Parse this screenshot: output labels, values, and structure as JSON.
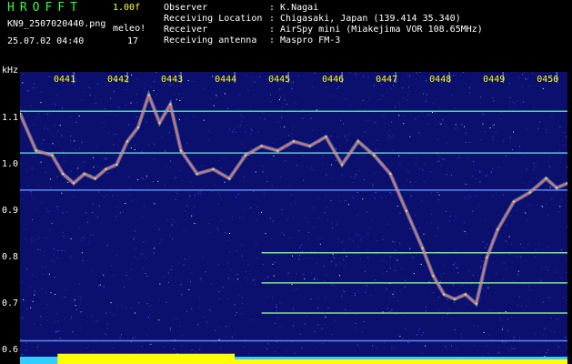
{
  "header": {
    "logo": "HROFFT",
    "version": "1.00f",
    "filename": "KN9_2507020440.png",
    "datetime": "25.07.02 04:40",
    "mode_label": "meleo!",
    "mode_value": "17",
    "meta": [
      {
        "label": "Observer",
        "value": ": K.Nagai"
      },
      {
        "label": "Receiving Location",
        "value": ": Chigasaki, Japan (139.414 35.340)"
      },
      {
        "label": "Receiver",
        "value": ": AirSpy mini (Miakejima VOR 108.65MHz)"
      },
      {
        "label": "Receiving antenna",
        "value": ": Maspro FM-3"
      }
    ]
  },
  "colors": {
    "logo": "#33ff33",
    "version": "#ffff33",
    "info": "#ffffff",
    "background": "#0b0f6e",
    "bright_band": "#ffff00",
    "cyan_band": "#33ccff",
    "trace": "#ff6666"
  },
  "chart_data": {
    "type": "heatmap",
    "ylabel": "kHz",
    "y_ticks": [
      "1.1",
      "1.0",
      "0.9",
      "0.8",
      "0.7",
      "0.6"
    ],
    "y_tick_values": [
      1.1,
      1.0,
      0.9,
      0.8,
      0.7,
      0.6
    ],
    "ylim": [
      0.57,
      1.2
    ],
    "x_ticks": [
      "0441",
      "0442",
      "0443",
      "0444",
      "0445",
      "0446",
      "0447",
      "0448",
      "0449",
      "0450"
    ],
    "x_tick_values": [
      1,
      2,
      3,
      4,
      5,
      6,
      7,
      8,
      9,
      10
    ],
    "xlim": [
      0,
      10.2
    ],
    "horizontal_lines": [
      {
        "y": 1.115,
        "x_start": 0,
        "x_end": 10.2,
        "color": "#66ddcc"
      },
      {
        "y": 1.025,
        "x_start": 0,
        "x_end": 10.2,
        "color": "#66ddcc"
      },
      {
        "y": 0.945,
        "x_start": 0,
        "x_end": 10.2,
        "color": "#6699ff"
      },
      {
        "y": 0.81,
        "x_start": 4.5,
        "x_end": 10.2,
        "color": "#88ff88"
      },
      {
        "y": 0.745,
        "x_start": 4.5,
        "x_end": 10.2,
        "color": "#88ff88"
      },
      {
        "y": 0.68,
        "x_start": 4.5,
        "x_end": 10.2,
        "color": "#88ff88"
      },
      {
        "y": 0.62,
        "x_start": 0,
        "x_end": 10.2,
        "color": "#6699ff"
      }
    ],
    "doppler_trace": {
      "x": [
        0,
        0.3,
        0.6,
        0.8,
        1.0,
        1.2,
        1.4,
        1.6,
        1.8,
        2.0,
        2.2,
        2.4,
        2.6,
        2.8,
        3.0,
        3.3,
        3.6,
        3.9,
        4.2,
        4.5,
        4.8,
        5.1,
        5.4,
        5.7,
        6.0,
        6.3,
        6.6,
        6.9,
        7.2,
        7.5,
        7.7,
        7.9,
        8.1,
        8.3,
        8.5,
        8.7,
        8.9,
        9.2,
        9.5,
        9.8,
        10.0,
        10.2
      ],
      "y": [
        1.11,
        1.03,
        1.02,
        0.98,
        0.96,
        0.98,
        0.97,
        0.99,
        1.0,
        1.05,
        1.08,
        1.15,
        1.09,
        1.13,
        1.03,
        0.98,
        0.99,
        0.97,
        1.02,
        1.04,
        1.03,
        1.05,
        1.04,
        1.06,
        1.0,
        1.05,
        1.02,
        0.98,
        0.9,
        0.82,
        0.76,
        0.72,
        0.71,
        0.72,
        0.7,
        0.8,
        0.86,
        0.92,
        0.94,
        0.97,
        0.95,
        0.96
      ]
    },
    "bottom_band": {
      "segments": [
        {
          "x_start": 0.7,
          "x_end": 4.0,
          "level": 1.0
        },
        {
          "x_start": 4.0,
          "x_end": 10.2,
          "level": 0.45
        }
      ]
    }
  }
}
